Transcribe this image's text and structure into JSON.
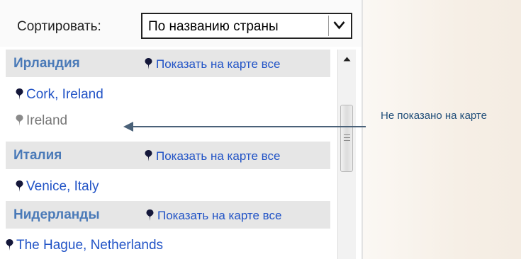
{
  "sort": {
    "label": "Сортировать:",
    "selected": "По названию страны"
  },
  "groups": [
    {
      "title": "Ирландия",
      "show_all": "Показать на карте все",
      "items": [
        {
          "label": "Cork, Ireland",
          "on_map": true
        },
        {
          "label": "Ireland",
          "on_map": false
        }
      ]
    },
    {
      "title": "Италия",
      "show_all": "Показать на карте все",
      "items": [
        {
          "label": "Venice, Italy",
          "on_map": true
        }
      ]
    },
    {
      "title": "Нидерланды",
      "show_all": "Показать на карте все",
      "items": [
        {
          "label": "The Hague, Netherlands",
          "on_map": true
        }
      ]
    }
  ],
  "annotation": {
    "text": "Не показано на карте"
  },
  "colors": {
    "link": "#2153c6",
    "header_text": "#4a7ab8",
    "header_bg": "#e6e6e6",
    "muted": "#777777",
    "annotation": "#4a6178"
  },
  "icons": {
    "pin": "map-pin-icon",
    "dropdown": "chevron-down-icon",
    "scroll_up": "arrow-up-icon"
  }
}
